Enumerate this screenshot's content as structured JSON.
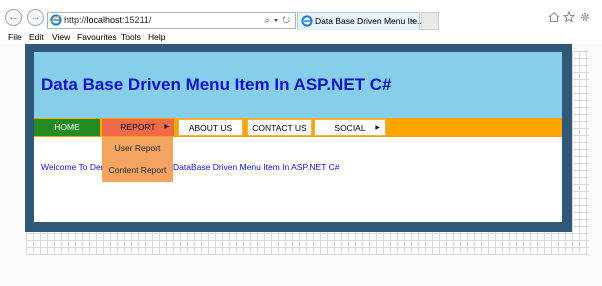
{
  "browser": {
    "url_prefix": "http://",
    "url_host": "localhost",
    "url_port": ":15211/",
    "address_icons": "⌕ ▾ ↻",
    "tab_title": "Data Base Driven Menu Ite...",
    "tab_close": "×",
    "back_glyph": "←",
    "forward_glyph": "→",
    "menu": [
      "File",
      "Edit",
      "View",
      "Favourites",
      "Tools",
      "Help"
    ],
    "toolbar_icons": [
      "home-icon",
      "star-icon",
      "gear-icon"
    ]
  },
  "page": {
    "title": "Data Base Driven Menu Item In ASP.NET C#",
    "nav": {
      "home": "HOME",
      "report": "REPORT",
      "about": "ABOUT US",
      "contact": "CONTACT US",
      "social": "SOCIAL",
      "arrow": "▶"
    },
    "submenu": [
      "User Report",
      "Content Report"
    ],
    "welcome_left": "Welcome To Der",
    "welcome_right": "DataBase Driven Menu Item In ASP.NET C#"
  },
  "colors": {
    "banner": "#87ceeb",
    "title_text": "#1212c8",
    "menu_strip": "#ffa500",
    "home_item": "#228b22",
    "report_item": "#f06a4a",
    "submenu": "#f4a460",
    "frame": "#2f5879"
  }
}
